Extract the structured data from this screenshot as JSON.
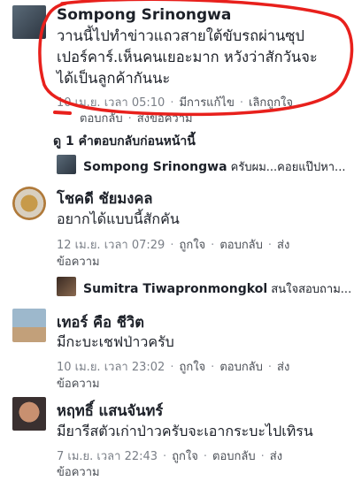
{
  "comments": [
    {
      "author": "Sompong Srinongwa",
      "text_lines": [
        "วานนี้ไปทำข่าวแถวสายใต้ขับรถผ่านซุป",
        "เปอร์คาร์.เห็นคนเยอะมาก หวังว่าสักวันจะ",
        "ได้เป็นลูกค้ากันนะ"
      ],
      "meta_line1": [
        "10 เม.ย. เวลา 05:10",
        "มีการแก้ไข",
        "เลิกถูกใจ"
      ],
      "meta_line2": [
        "ตอบกลับ",
        "ส่งข้อความ"
      ]
    },
    {
      "author": "โชคดี ชัยมงคล",
      "text_lines": [
        "อยากได้แบบนี้สักคัน"
      ],
      "meta_line1": [
        "12 เม.ย. เวลา 07:29",
        "ถูกใจ",
        "ตอบกลับ",
        "ส่ง"
      ],
      "meta_line2": [
        "ข้อความ"
      ]
    },
    {
      "author": "เทอร์ คือ ชีวิต",
      "text_lines": [
        "มีกะบะเชฟป่าวครับ"
      ],
      "meta_line1": [
        "10 เม.ย. เวลา 23:02",
        "ถูกใจ",
        "ตอบกลับ",
        "ส่ง"
      ],
      "meta_line2": [
        "ข้อความ"
      ]
    },
    {
      "author": "หฤทธิ์ แสนจันทร์",
      "text_lines": [
        "มียารีสตัวเก่าป่าวครับจะเอากระบะไปเทิรน"
      ],
      "meta_line1": [
        "7 เม.ย. เวลา 22:43",
        "ถูกใจ",
        "ตอบกลับ",
        "ส่ง"
      ],
      "meta_line2": [
        "ข้อความ"
      ]
    }
  ],
  "previous_replies_label": "ดู 1 คำตอบกลับก่อนหน้านี้",
  "replies": [
    {
      "author": "Sompong Srinongwa",
      "text": "ครับผม...คอยแป๊ปหา..."
    },
    {
      "author": "Sumitra Tiwapronmongkol",
      "text": "สนใจสอบถาม..."
    }
  ],
  "colors": {
    "highlight_circle": "#e8201c",
    "link": "#4b4f56",
    "timestamp": "#7a7f87"
  }
}
